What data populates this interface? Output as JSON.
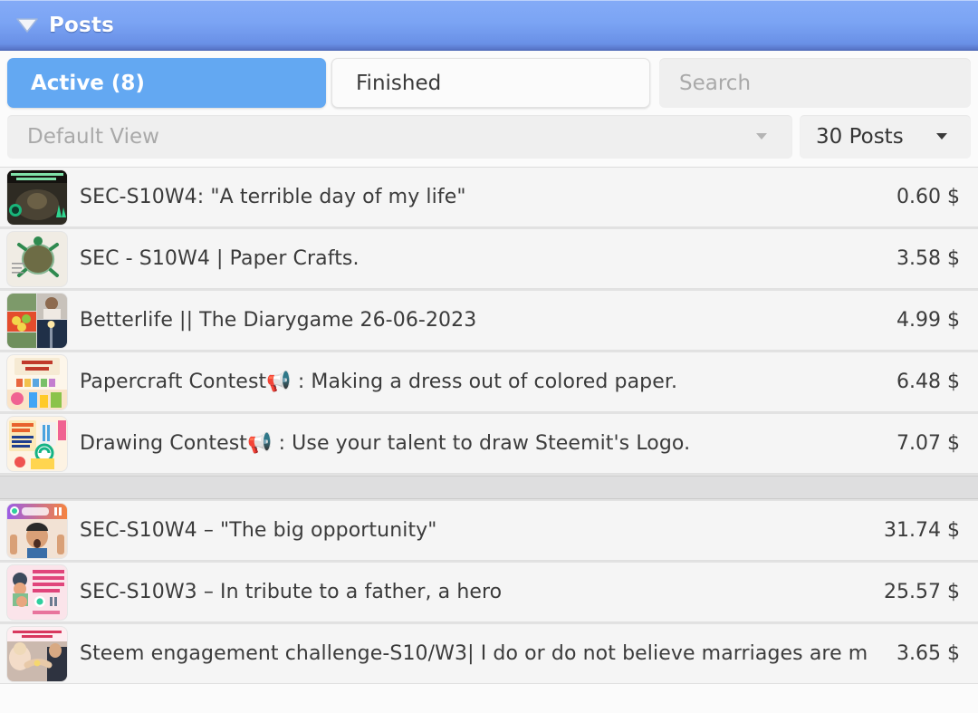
{
  "window": {
    "title": "Posts",
    "collapse_icon": "triangle-down-icon",
    "header_gradient_top": "#84abf7",
    "header_gradient_bottom": "#5572c4"
  },
  "tabs": [
    {
      "label": "Active (8)",
      "state": "active",
      "accent": "#63a8f2"
    },
    {
      "label": "Finished",
      "state": "inactive"
    }
  ],
  "search": {
    "placeholder": "Search",
    "value": ""
  },
  "filters": {
    "view": {
      "value": "Default View",
      "caret": "chevron-down-icon"
    },
    "count": {
      "value": "30 Posts",
      "caret": "chevron-down-icon"
    }
  },
  "posts": [
    {
      "title": "SEC-S10W4: \"A terrible day of my life\"",
      "value": "0.60 $",
      "thumb": "dark-jungle-thumb"
    },
    {
      "title": "SEC - S10W4 | Paper Crafts.",
      "value": "3.58 $",
      "thumb": "paper-turtle-thumb"
    },
    {
      "title": "Betterlife || The Diarygame 26-06-2023",
      "value": "4.99 $",
      "thumb": "photo-collage-thumb"
    },
    {
      "title": "Papercraft Contest📢 : Making a dress out of colored paper.",
      "value": "6.48 $",
      "thumb": "papercraft-contest-thumb"
    },
    {
      "title": "Drawing Contest📢 : Use your talent to draw Steemit's Logo.",
      "value": "7.07 $",
      "thumb": "drawing-contest-thumb"
    },
    {
      "separator": true
    },
    {
      "title": "SEC-S10W4 – \"The big opportunity\"",
      "value": "31.74 $",
      "thumb": "big-opportunity-thumb"
    },
    {
      "title": "SEC-S10W3 – In tribute to a father, a hero",
      "value": "25.57 $",
      "thumb": "tribute-father-thumb"
    },
    {
      "title": "Steem engagement challenge-S10/W3| I do or do not believe marriages are m",
      "value": "3.65 $",
      "thumb": "marriage-thumb"
    }
  ]
}
